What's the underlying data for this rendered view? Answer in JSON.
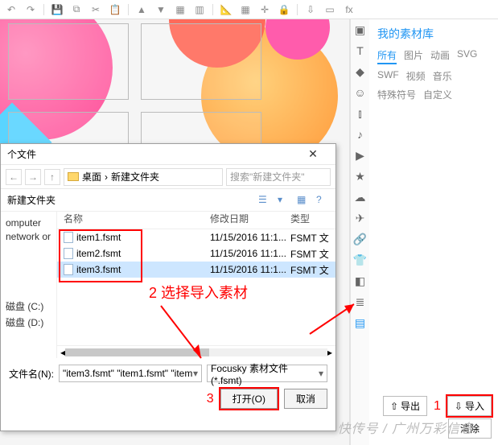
{
  "toolbar_icons": [
    "undo",
    "redo",
    "save",
    "copy",
    "cut",
    "paste",
    "forward",
    "back",
    "group",
    "ungroup",
    "ruler",
    "grid",
    "snap",
    "lock",
    "import",
    "template",
    "fx"
  ],
  "vstrip_icons": [
    "image",
    "text",
    "shape",
    "icon-lib",
    "chart",
    "music",
    "video",
    "star",
    "cloud-down",
    "plane",
    "link",
    "shirt",
    "cube",
    "layers",
    "material"
  ],
  "panel": {
    "title": "我的素材库",
    "tabs": [
      "所有",
      "图片",
      "动画",
      "SVG",
      "SWF",
      "视频",
      "音乐",
      "特殊符号",
      "自定义"
    ],
    "active_tab": 0,
    "export_label": "导出",
    "import_label": "导入",
    "clear_label": "清除",
    "num_label": "1"
  },
  "dialog": {
    "title": "个文件",
    "breadcrumb": [
      "桌面",
      "新建文件夹"
    ],
    "search_placeholder": "搜索\"新建文件夹\"",
    "new_folder_label": "新建文件夹",
    "sidebar": [
      "omputer",
      "network or",
      "",
      "",
      "",
      "",
      "磁盘 (C:)",
      "磁盘 (D:)"
    ],
    "columns": [
      "名称",
      "修改日期",
      "类型"
    ],
    "rows": [
      {
        "name": "item1.fsmt",
        "date": "11/15/2016 11:1...",
        "type": "FSMT 文",
        "selected": false
      },
      {
        "name": "item2.fsmt",
        "date": "11/15/2016 11:1...",
        "type": "FSMT 文",
        "selected": false
      },
      {
        "name": "item3.fsmt",
        "date": "11/15/2016 11:1...",
        "type": "FSMT 文",
        "selected": true
      }
    ],
    "filename_label": "文件名(N):",
    "filename_value": "\"item3.fsmt\" \"item1.fsmt\" \"item",
    "filter_value": "Focusky 素材文件(*.fsmt)",
    "open_label": "打开(O)",
    "cancel_label": "取消",
    "num_label": "3"
  },
  "annotations": {
    "select_text": "2 选择导入素材"
  },
  "watermark": "快传号 / 广州万彩信息"
}
